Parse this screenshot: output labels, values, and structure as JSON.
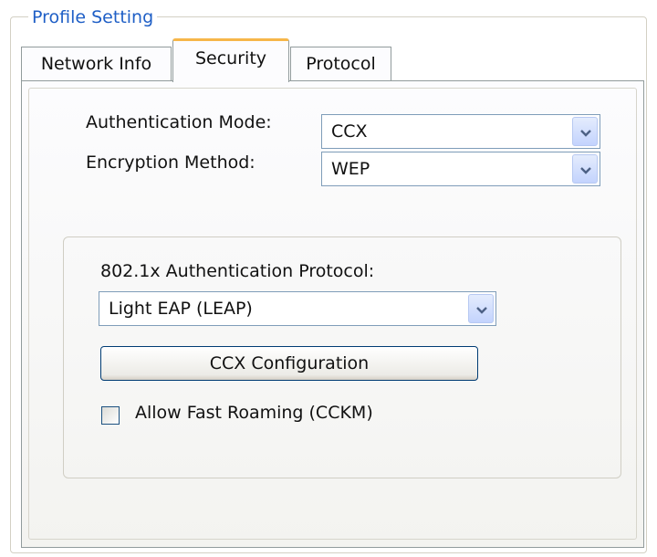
{
  "group": {
    "title": "Profile Setting"
  },
  "tabs": [
    {
      "label": "Network Info"
    },
    {
      "label": "Security",
      "selected": true
    },
    {
      "label": "Protocol"
    }
  ],
  "security": {
    "auth_mode_label": "Authentication Mode:",
    "auth_mode_value": "CCX",
    "encryption_label": "Encryption Method:",
    "encryption_value": "WEP",
    "protocol_label": "802.1x Authentication Protocol:",
    "protocol_value": "Light EAP (LEAP)",
    "ccx_button_label": "CCX Configuration",
    "fast_roaming_label": "Allow Fast Roaming (CCKM)",
    "fast_roaming_checked": false
  },
  "icons": {
    "dropdown": "chevron-down-icon",
    "checkbox": "checkbox-unchecked-icon"
  },
  "colors": {
    "title_blue": "#1f5fc6",
    "tab_highlight": "#f6b64a",
    "control_border": "#7f9db9"
  }
}
